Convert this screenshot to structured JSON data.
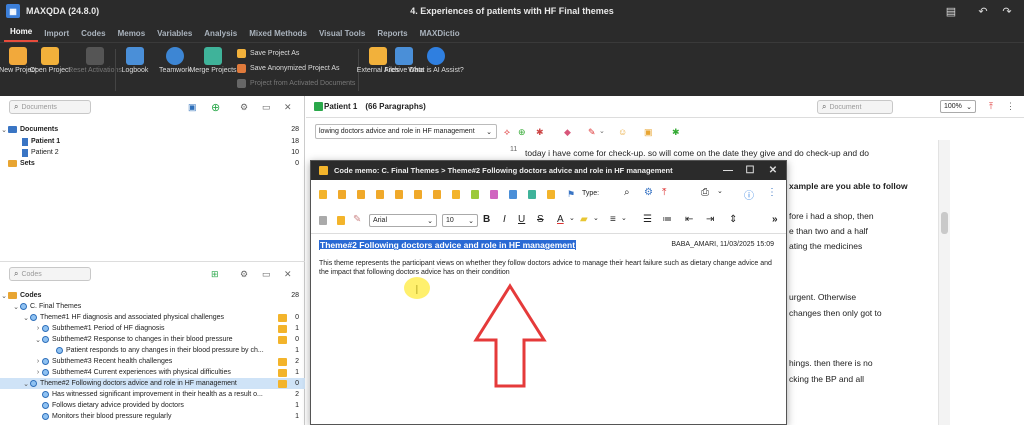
{
  "titlebar": {
    "app": "MAXQDA (24.8.0)",
    "document": "4. Experiences of patients with HF Final themes"
  },
  "menu": [
    "Home",
    "Import",
    "Codes",
    "Memos",
    "Variables",
    "Analysis",
    "Mixed Methods",
    "Visual Tools",
    "Reports",
    "MAXDictio"
  ],
  "ribbon": {
    "new_project": "New Project",
    "open_project": "Open Project",
    "reset_activations": "Reset Activations",
    "logbook": "Logbook",
    "teamwork": "Teamwork",
    "merge_projects": "Merge Projects",
    "save_project_as": "Save Project As",
    "save_anonymized": "Save Anonymized Project As",
    "project_from_activated": "Project from Activated Documents",
    "external_files": "External Files",
    "archive_data": "Archive Data",
    "ai_assist": "What is AI Assist?"
  },
  "documents": {
    "search_placeholder": "Documents",
    "root": {
      "label": "Documents",
      "count": "28"
    },
    "items": [
      {
        "label": "Patient 1",
        "count": "18"
      },
      {
        "label": "Patient 2",
        "count": "10"
      }
    ],
    "sets": {
      "label": "Sets",
      "count": "0"
    }
  },
  "codes": {
    "search_placeholder": "Codes",
    "root": {
      "label": "Codes",
      "count": "28"
    },
    "items": [
      {
        "label": "C. Final Themes",
        "count": ""
      },
      {
        "label": "Theme#1 HF diagnosis and associated physical challenges",
        "count": "0"
      },
      {
        "label": "Subtheme#1 Period of HF diagnosis",
        "count": "1"
      },
      {
        "label": "Subtheme#2 Response to changes in their blood pressure",
        "count": "0"
      },
      {
        "label": "Patient responds to any changes in their blood pressure by ch...",
        "count": "1"
      },
      {
        "label": "Subtheme#3 Recent health challenges",
        "count": "2"
      },
      {
        "label": "Subtheme#4 Current experiences with physical difficulties",
        "count": "1"
      },
      {
        "label": "Theme#2 Following doctors advice and role in HF management",
        "count": "0"
      },
      {
        "label": "Has witnessed significant improvement in their health as a result o...",
        "count": "2"
      },
      {
        "label": "Follows dietary advice provided by doctors",
        "count": "1"
      },
      {
        "label": "Monitors their blood pressure regularly",
        "count": "1"
      }
    ]
  },
  "browser": {
    "title": "Patient 1",
    "paragraphs": "(66 Paragraphs)",
    "search_placeholder": "Document",
    "zoom": "100%",
    "code_selector": "lowing doctors advice and role in HF management",
    "line_number": "11",
    "lines": [
      "today i have come for check-up. so will come on the date they give and do check-up and do",
      "xample are you able to follow",
      "fore i had a shop, then",
      "e than two and a half",
      "ating the medicines",
      "urgent. Otherwise",
      "changes then only got to",
      "hings. then there is no",
      "cking the BP and all"
    ]
  },
  "memo": {
    "window_title": "Code memo: C. Final Themes > Theme#2 Following doctors advice and role in HF management",
    "type_label": "Type:",
    "font": "Arial",
    "size": "10",
    "heading": "Theme#2 Following doctors advice and role in HF management",
    "author": "BABA_AMARI, 11/03/2025 15:09",
    "body": "This theme represents the participant views on whether they follow doctors advice to manage their heart failure such as dietary change advice and the impact that following doctors advice has on their condition"
  },
  "colors": {
    "accent": "#e74c3c",
    "selection": "#2a6ad4",
    "memo": "#f3b42b",
    "dark": "#2b2b2b"
  }
}
